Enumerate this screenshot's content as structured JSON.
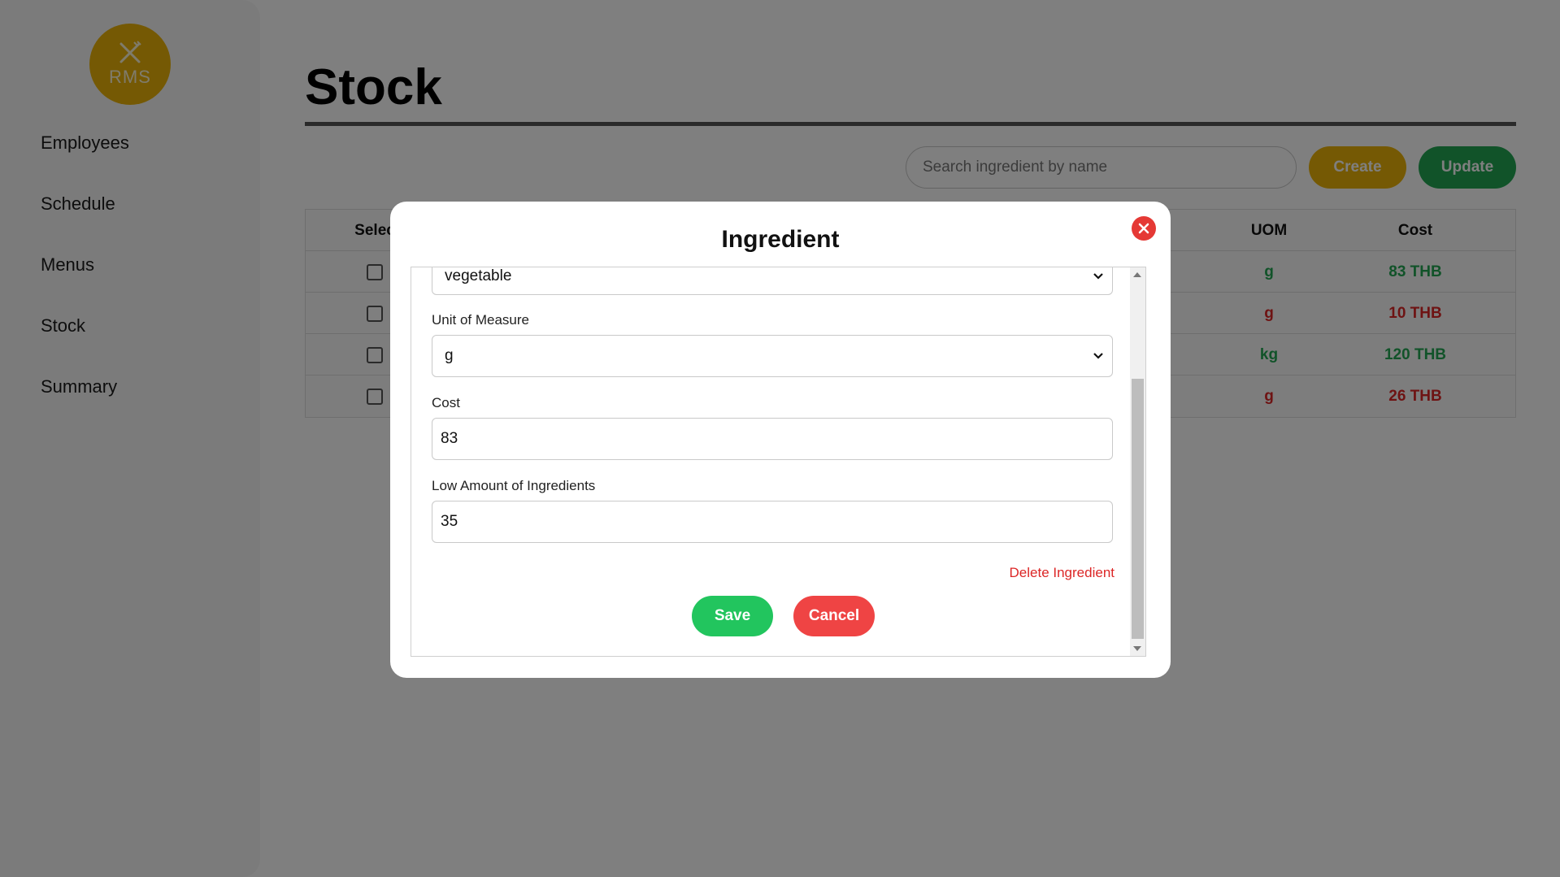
{
  "app": {
    "logo_text": "RMS"
  },
  "sidebar": {
    "items": [
      {
        "label": "Employees"
      },
      {
        "label": "Schedule"
      },
      {
        "label": "Menus"
      },
      {
        "label": "Stock"
      },
      {
        "label": "Summary"
      }
    ]
  },
  "page": {
    "title": "Stock"
  },
  "toolbar": {
    "search_placeholder": "Search ingredient by name",
    "create_label": "Create",
    "update_label": "Update"
  },
  "table": {
    "headers": {
      "select": "Selec",
      "uom": "UOM",
      "cost": "Cost"
    },
    "rows": [
      {
        "uom": "g",
        "cost": "83 THB",
        "status": "ok"
      },
      {
        "uom": "g",
        "cost": "10 THB",
        "status": "low"
      },
      {
        "uom": "kg",
        "cost": "120 THB",
        "status": "ok"
      },
      {
        "uom": "g",
        "cost": "26 THB",
        "status": "low"
      }
    ]
  },
  "modal": {
    "title": "Ingredient",
    "category_value": "vegetable",
    "uom_label": "Unit of Measure",
    "uom_value": "g",
    "cost_label": "Cost",
    "cost_value": "83",
    "low_amount_label": "Low Amount of Ingredients",
    "low_amount_value": "35",
    "delete_label": "Delete Ingredient",
    "save_label": "Save",
    "cancel_label": "Cancel"
  },
  "colors": {
    "accent_yellow": "#eab308",
    "green": "#22a652",
    "red": "#dc2626",
    "save_green": "#22c55e",
    "cancel_red": "#ef4444"
  },
  "icons": {
    "logo": "utensils-icon",
    "close": "close-icon",
    "dropdown": "chevron-down-icon"
  }
}
